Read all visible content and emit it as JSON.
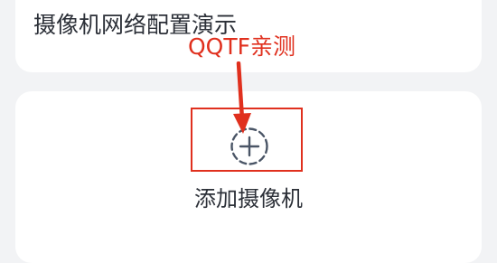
{
  "previous_card": {
    "title": "摄像机网络配置演示"
  },
  "add_card": {
    "icon": "add-circle-dashed-icon",
    "label": "添加摄像机"
  },
  "annotation": {
    "text": "QQTF亲测",
    "color": "#e0301e"
  },
  "colors": {
    "background": "#f2f3f5",
    "card": "#ffffff",
    "text": "#2c3038",
    "icon": "#4a5566",
    "annotation": "#e0301e"
  }
}
